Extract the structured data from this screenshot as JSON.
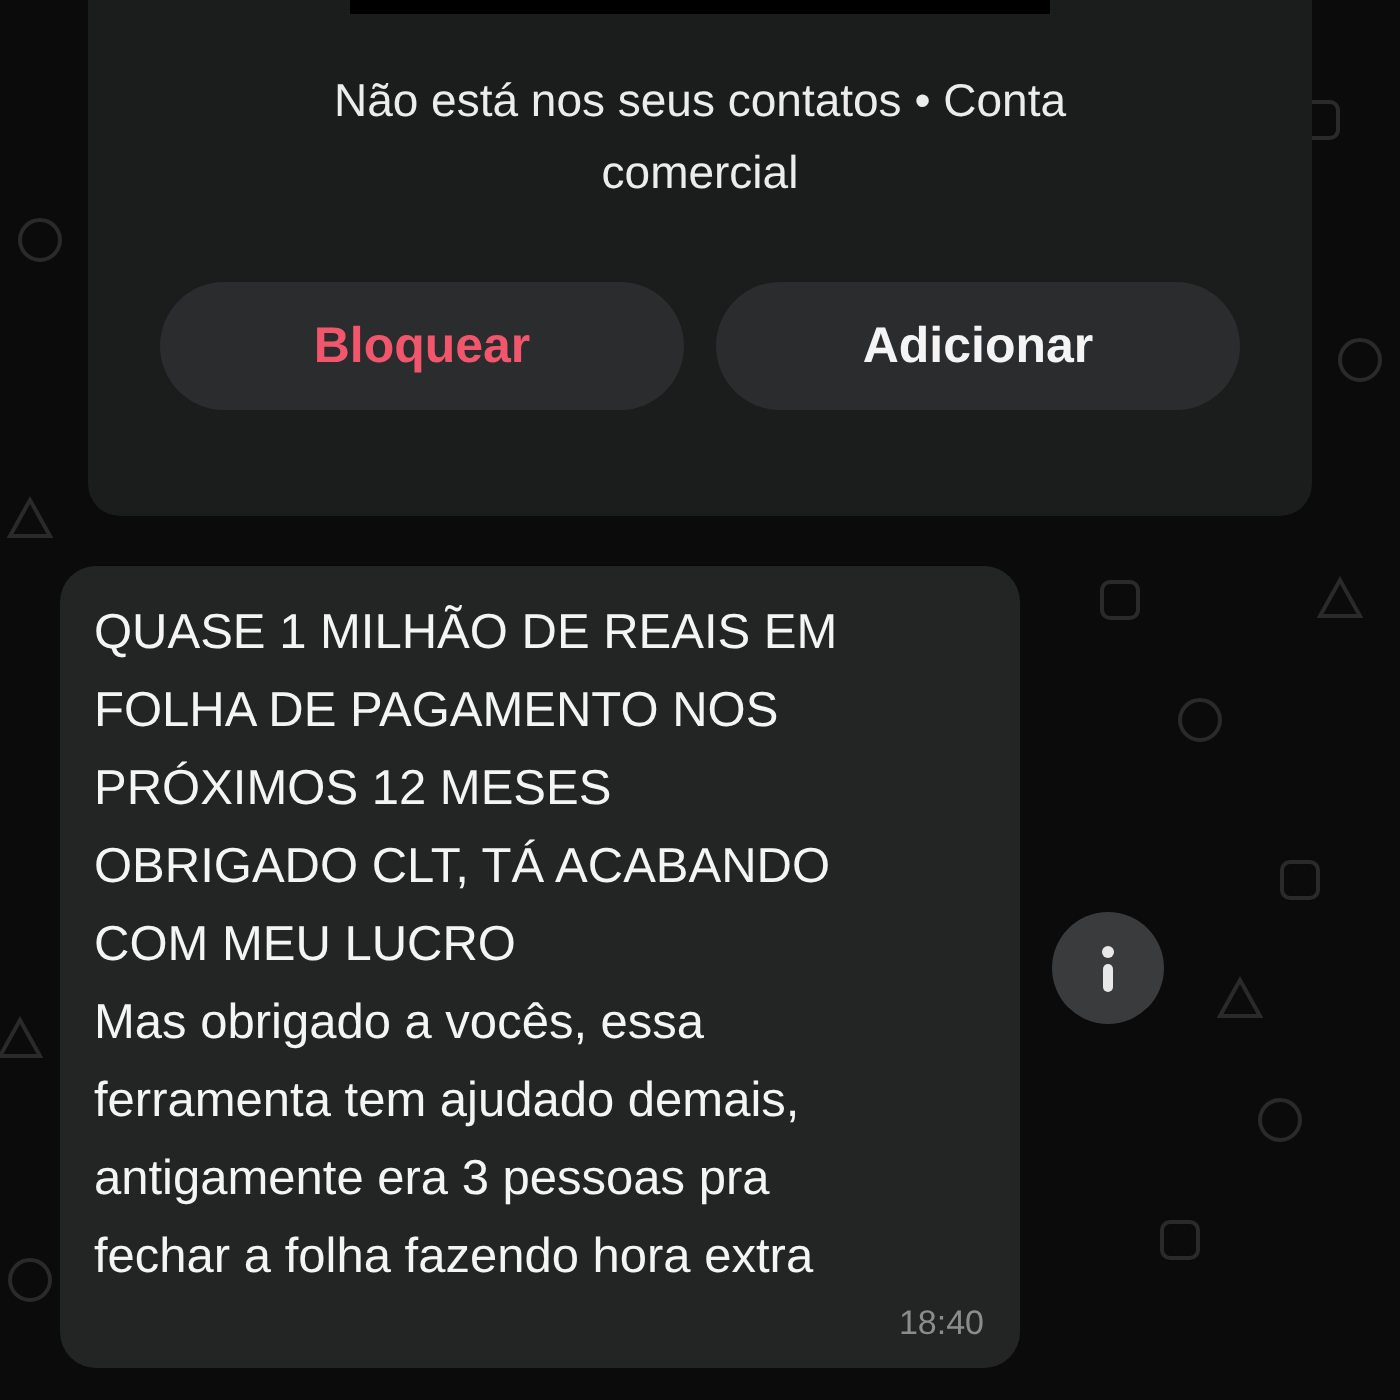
{
  "contact_card": {
    "subtitle_line_1": "Não está nos seus contatos • Conta",
    "subtitle_line_2": "comercial",
    "buttons": [
      {
        "label": "Bloquear",
        "kind": "danger"
      },
      {
        "label": "Adicionar",
        "kind": "normal"
      }
    ]
  },
  "message": {
    "lines": [
      "QUASE 1 MILHÃO DE REAIS EM",
      "FOLHA DE PAGAMENTO NOS",
      "PRÓXIMOS 12 MESES",
      "OBRIGADO CLT, TÁ ACABANDO",
      "COM MEU LUCRO",
      "Mas obrigado a vocês, essa",
      "ferramenta tem ajudado demais,",
      "antigamente era 3 pessoas pra",
      "fechar a folha fazendo hora extra"
    ],
    "time": "18:40"
  }
}
